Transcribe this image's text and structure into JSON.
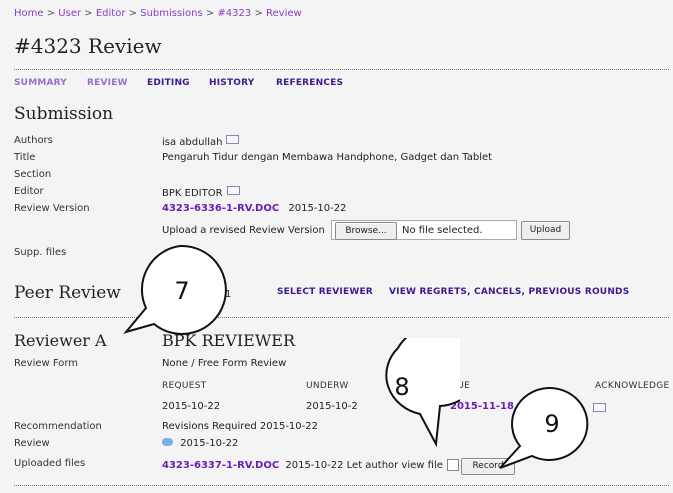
{
  "breadcrumb": {
    "items": [
      "Home",
      "User",
      "Editor",
      "Submissions",
      "#4323",
      "Review"
    ],
    "separator": ">"
  },
  "page_title": "#4323 Review",
  "tabs": [
    "SUMMARY",
    "REVIEW",
    "EDITING",
    "HISTORY",
    "REFERENCES"
  ],
  "submission": {
    "heading": "Submission",
    "labels": {
      "authors": "Authors",
      "title": "Title",
      "section": "Section",
      "editor": "Editor",
      "review_version": "Review Version",
      "supp_files": "Supp. files"
    },
    "authors_value": "isa abdullah",
    "title_value": "Pengaruh Tidur dengan Membawa Handphone, Gadget dan Tablet",
    "editor_value": "BPK EDITOR",
    "review_version_file": "4323-6336-1-RV.DOC",
    "review_version_date": "2015-10-22",
    "upload_label": "Upload a revised Review Version",
    "browse_label": "Browse...",
    "file_status": "No file selected.",
    "upload_button": "Upload"
  },
  "peer_review": {
    "heading": "Peer Review",
    "partial_text": "1",
    "select_reviewer": "SELECT REVIEWER",
    "view_regrets": "VIEW REGRETS, CANCELS, PREVIOUS ROUNDS"
  },
  "reviewer": {
    "heading": "Reviewer A",
    "name": "BPK REVIEWER",
    "labels": {
      "review_form": "Review Form",
      "recommendation": "Recommendation",
      "review": "Review",
      "uploaded_files": "Uploaded files"
    },
    "review_form_value": "None / Free Form Review",
    "col_request": "REQUEST",
    "col_underway": "UNDERW",
    "col_due": "DUE",
    "col_acknowledge": "ACKNOWLEDGE",
    "request_date": "2015-10-22",
    "underway_date": "2015-10-2",
    "due_date": "2015-11-18",
    "recommendation_value": "Revisions Required  2015-10-22",
    "review_date": "2015-10-22",
    "uploaded_file": "4323-6337-1-RV.DOC",
    "uploaded_text": "2015-10-22 Let author view file",
    "record_button": "Record"
  },
  "callouts": [
    "7",
    "8",
    "9"
  ],
  "colors": {
    "link_purple": "#6a1fb4",
    "breadcrumb_purple": "#8a3fc0",
    "tab_dark": "#3d1a8f"
  }
}
